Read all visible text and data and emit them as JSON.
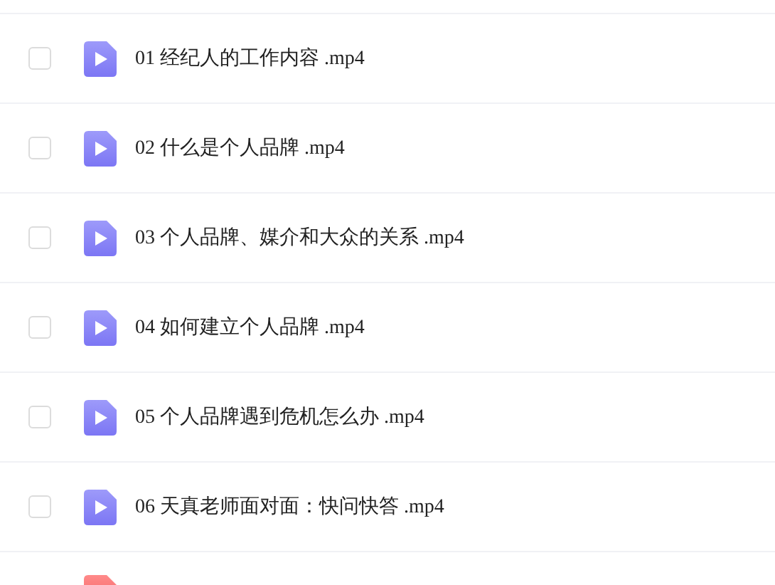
{
  "files": [
    {
      "kind": "video",
      "name": "01 经纪人的工作内容 .mp4",
      "checked": false
    },
    {
      "kind": "video",
      "name": "02 什么是个人品牌 .mp4",
      "checked": false
    },
    {
      "kind": "video",
      "name": "03 个人品牌、媒介和大众的关系 .mp4",
      "checked": false
    },
    {
      "kind": "video",
      "name": "04 如何建立个人品牌 .mp4",
      "checked": false
    },
    {
      "kind": "video",
      "name": "05 个人品牌遇到危机怎么办 .mp4",
      "checked": false
    },
    {
      "kind": "video",
      "name": "06 天真老师面对面：快问快答 .mp4",
      "checked": false
    },
    {
      "kind": "document"
    }
  ]
}
